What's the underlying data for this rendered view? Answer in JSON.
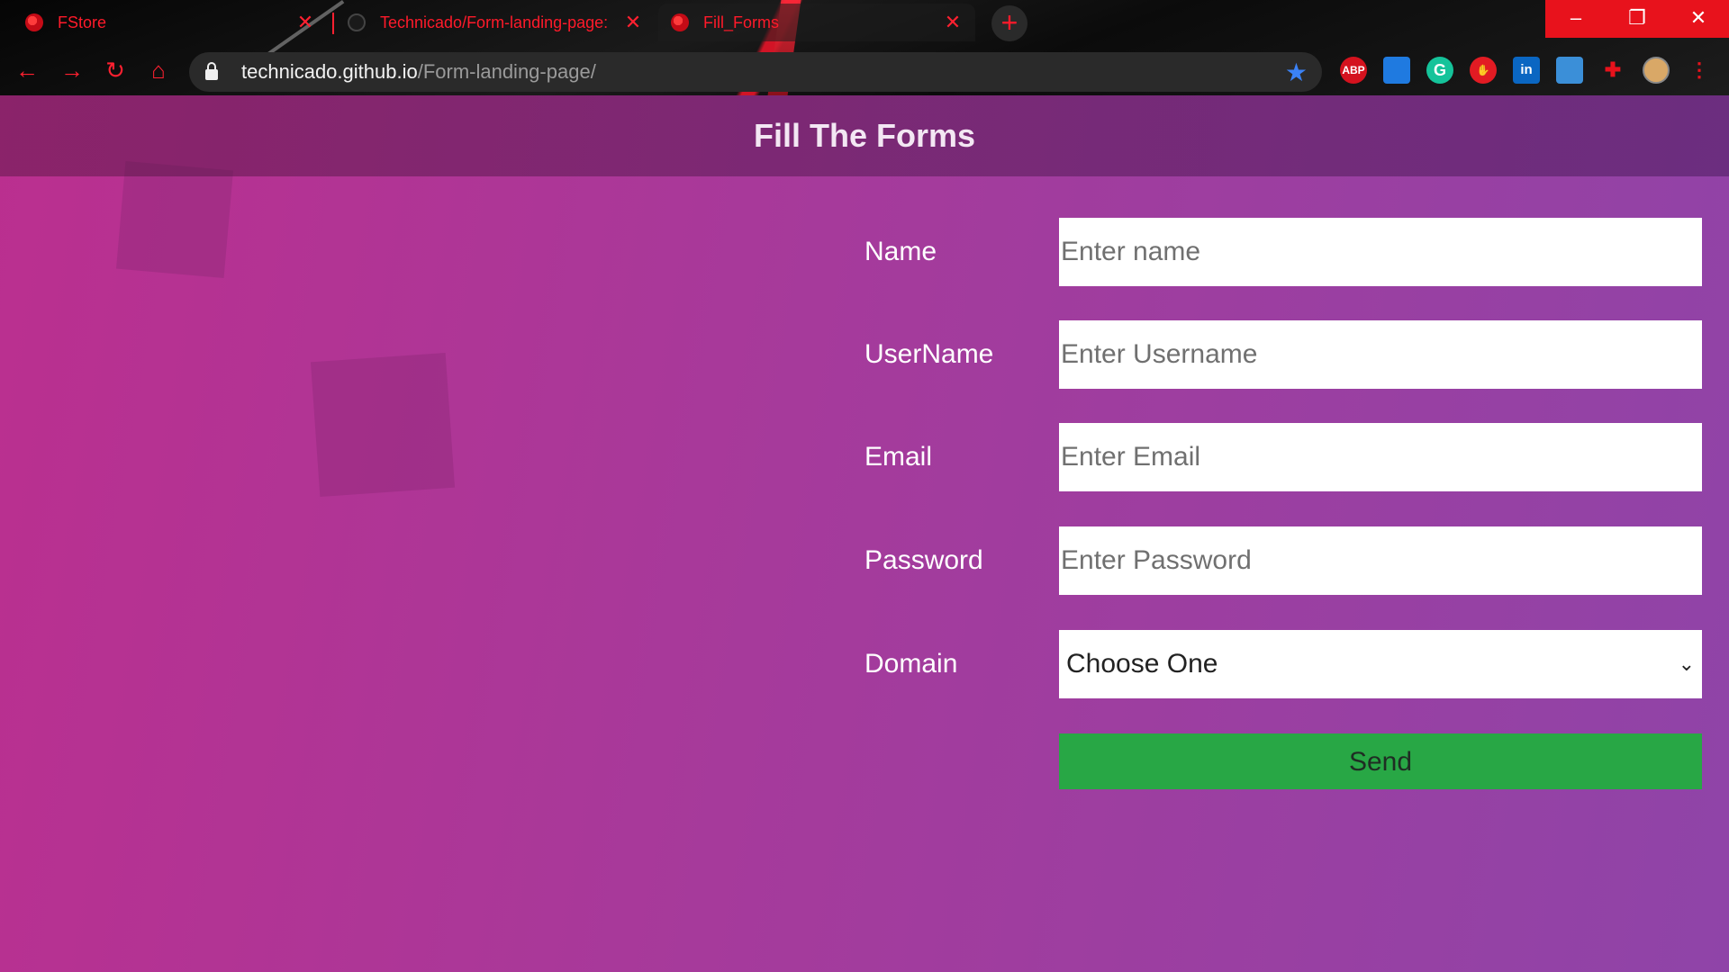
{
  "browser": {
    "tabs": [
      {
        "title": "FStore",
        "active": false
      },
      {
        "title": "Technicado/Form-landing-page:",
        "active": false
      },
      {
        "title": "Fill_Forms",
        "active": true
      }
    ],
    "url_host": "technicado.github.io",
    "url_path": "/Form-landing-page/",
    "extensions": [
      "ABP",
      "G"
    ],
    "accent_color": "#ff1a2a"
  },
  "page": {
    "title": "Fill The Forms",
    "fields": {
      "name": {
        "label": "Name",
        "placeholder": "Enter name"
      },
      "username": {
        "label": "UserName",
        "placeholder": "Enter Username"
      },
      "email": {
        "label": "Email",
        "placeholder": "Enter Email"
      },
      "password": {
        "label": "Password",
        "placeholder": "Enter Password"
      },
      "domain": {
        "label": "Domain",
        "selected": "Choose One"
      }
    },
    "submit_label": "Send",
    "button_color": "#28a745"
  }
}
